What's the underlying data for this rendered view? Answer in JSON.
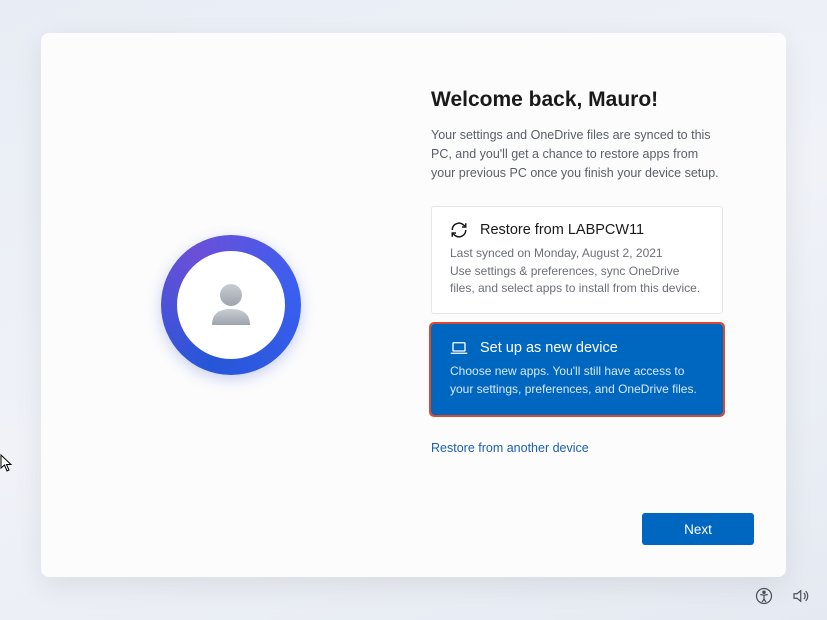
{
  "header": {
    "title": "Welcome back, Mauro!",
    "subtitle": "Your settings and OneDrive files are synced to this PC, and you'll get a chance to restore apps from your previous PC once you finish your device setup."
  },
  "options": {
    "restore": {
      "title": "Restore from LABPCW11",
      "line1": "Last synced on Monday, August 2, 2021",
      "line2": "Use settings & preferences, sync OneDrive files, and select apps to install from this device."
    },
    "new_device": {
      "title": "Set up as new device",
      "desc": "Choose new apps. You'll still have access to your settings, preferences, and OneDrive files."
    }
  },
  "link": {
    "another_device": "Restore from another device"
  },
  "buttons": {
    "next": "Next"
  }
}
